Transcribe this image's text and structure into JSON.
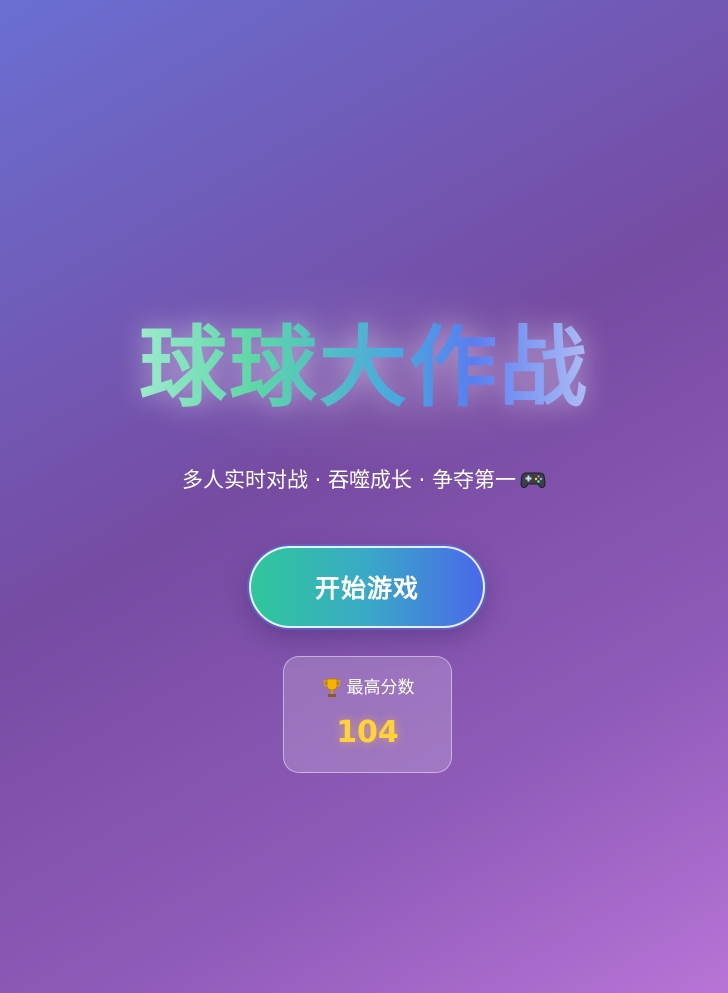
{
  "title": "球球大作战",
  "subtitle": "多人实时对战 · 吞噬成长 · 争夺第一",
  "subtitle_icon": "gamepad-icon",
  "start_button": {
    "label": "开始游戏"
  },
  "high_score": {
    "icon": "trophy-icon",
    "label": "最高分数",
    "value": "104"
  },
  "colors": {
    "background_start": "#6a6fd2",
    "background_end": "#b874d6",
    "button_start": "#2fc79a",
    "button_end": "#4a68ea",
    "score_value": "#ffd23c"
  }
}
